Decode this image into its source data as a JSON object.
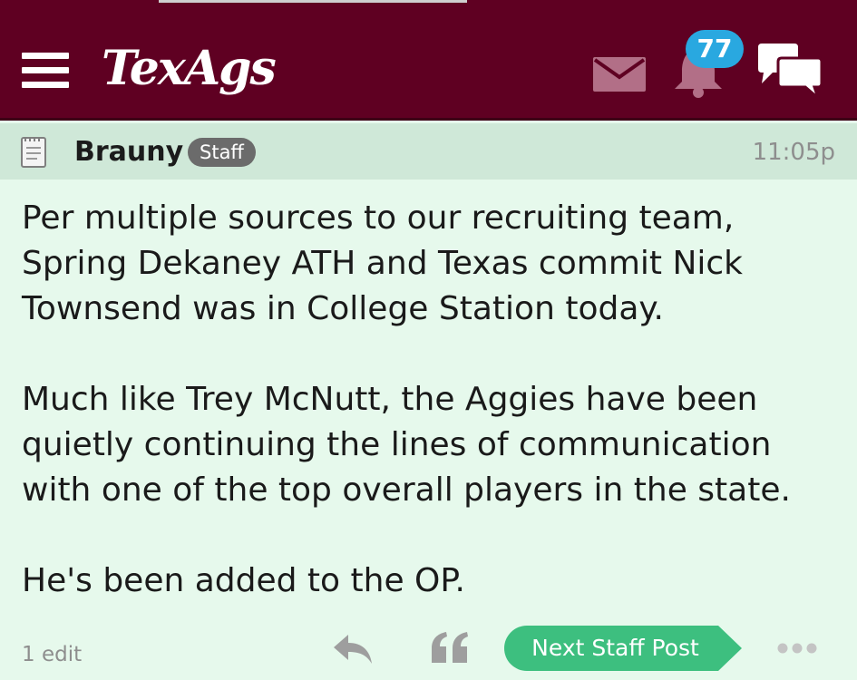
{
  "header": {
    "logo": "TexAgs",
    "notification_count": "77",
    "icons": [
      "hamburger-menu-icon",
      "mail-icon",
      "bell-icon",
      "chat-icon"
    ],
    "colors": {
      "bar": "#5f0022",
      "badge": "#29a8e0"
    }
  },
  "post": {
    "author": "Brauny",
    "role_badge": "Staff",
    "time": "11:05p",
    "paragraphs": [
      "Per multiple sources to our recruiting team, Spring Dekaney ATH and Texas commit Nick Townsend was in College Station today.",
      "Much like Trey McNutt, the Aggies have been quietly continuing the lines of communication with one of the top overall players in the state.",
      "He's been added to the OP."
    ],
    "colors": {
      "background": "#e6f9ec",
      "header_band": "#cfe8d8"
    }
  },
  "footer": {
    "edit_count": "1 edit",
    "next_button": "Next Staff Post",
    "icons": [
      "reply-icon",
      "quote-icon",
      "more-options-icon"
    ],
    "colors": {
      "next_button": "#3dbf7f"
    }
  }
}
